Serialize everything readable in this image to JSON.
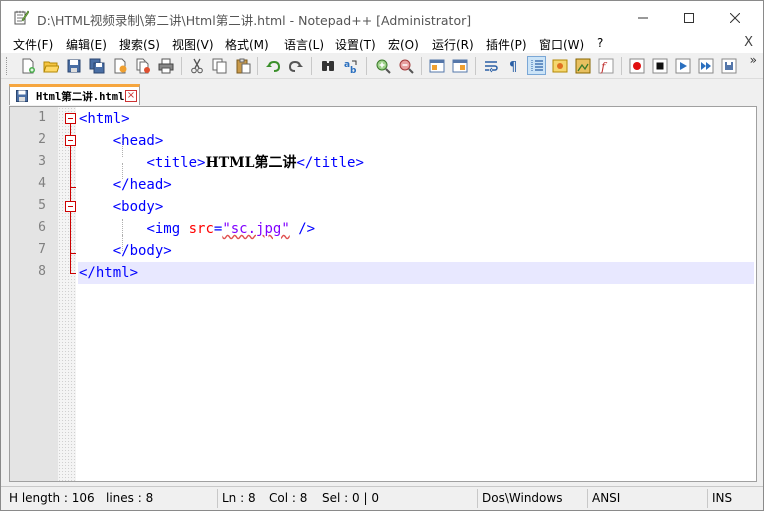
{
  "window": {
    "title": "D:\\HTML视频录制\\第二讲\\Html第二讲.html - Notepad++ [Administrator]"
  },
  "menu": {
    "items": [
      "文件(F)",
      "编辑(E)",
      "搜索(S)",
      "视图(V)",
      "格式(M)",
      "语言(L)",
      "设置(T)",
      "宏(O)",
      "运行(R)",
      "插件(P)",
      "窗口(W)",
      "?"
    ],
    "close": "X"
  },
  "toolbar": {
    "buttons": [
      "new-file",
      "open-file",
      "save",
      "save-all",
      "close",
      "close-all",
      "print",
      "cut",
      "copy",
      "paste",
      "undo",
      "redo",
      "find",
      "replace",
      "zoom-in",
      "zoom-out",
      "sync-vertical",
      "sync-horizontal",
      "word-wrap",
      "show-all-chars",
      "indent-guide",
      "user-define-lang",
      "doc-map",
      "function-list",
      "record-macro",
      "stop-record",
      "play-macro",
      "run-macro-multiple",
      "save-macro"
    ],
    "overflow": "»"
  },
  "tabs": [
    {
      "label": "Html第二讲.html",
      "active": true
    }
  ],
  "editor": {
    "line_numbers": [
      "1",
      "2",
      "3",
      "4",
      "5",
      "6",
      "7",
      "8"
    ],
    "lines": [
      {
        "indent": "",
        "parts": [
          {
            "t": "tag",
            "v": "<html>"
          }
        ]
      },
      {
        "indent": "    ",
        "parts": [
          {
            "t": "tag",
            "v": "<head>"
          }
        ]
      },
      {
        "indent": "        ",
        "parts": [
          {
            "t": "tag",
            "v": "<title>"
          },
          {
            "t": "text",
            "v": "HTML第二讲"
          },
          {
            "t": "tag",
            "v": "</title>"
          }
        ]
      },
      {
        "indent": "    ",
        "parts": [
          {
            "t": "tag",
            "v": "</head>"
          }
        ]
      },
      {
        "indent": "    ",
        "parts": [
          {
            "t": "tag",
            "v": "<body>"
          }
        ]
      },
      {
        "indent": "        ",
        "parts": [
          {
            "t": "tag",
            "v": "<img "
          },
          {
            "t": "attr",
            "v": "src"
          },
          {
            "t": "tag",
            "v": "="
          },
          {
            "t": "str",
            "v": "\"sc.jpg\""
          },
          {
            "t": "tag",
            "v": " />"
          }
        ]
      },
      {
        "indent": "    ",
        "parts": [
          {
            "t": "tag",
            "v": "</body>"
          }
        ]
      },
      {
        "indent": "",
        "parts": [
          {
            "t": "tag",
            "v": "</html>"
          }
        ]
      }
    ],
    "current_line": 8
  },
  "status": {
    "length": "H length : 106",
    "lines": "lines : 8",
    "ln": "Ln : 8",
    "col": "Col : 8",
    "sel": "Sel : 0 | 0",
    "eol": "Dos\\Windows",
    "encoding": "ANSI",
    "mode": "INS"
  },
  "colors": {
    "tag": "#0000ff",
    "attr": "#ff0000",
    "string": "#8000ff",
    "tab_accent": "#f6a63f",
    "current_line": "#e8e8ff",
    "fold": "#cc0000"
  }
}
